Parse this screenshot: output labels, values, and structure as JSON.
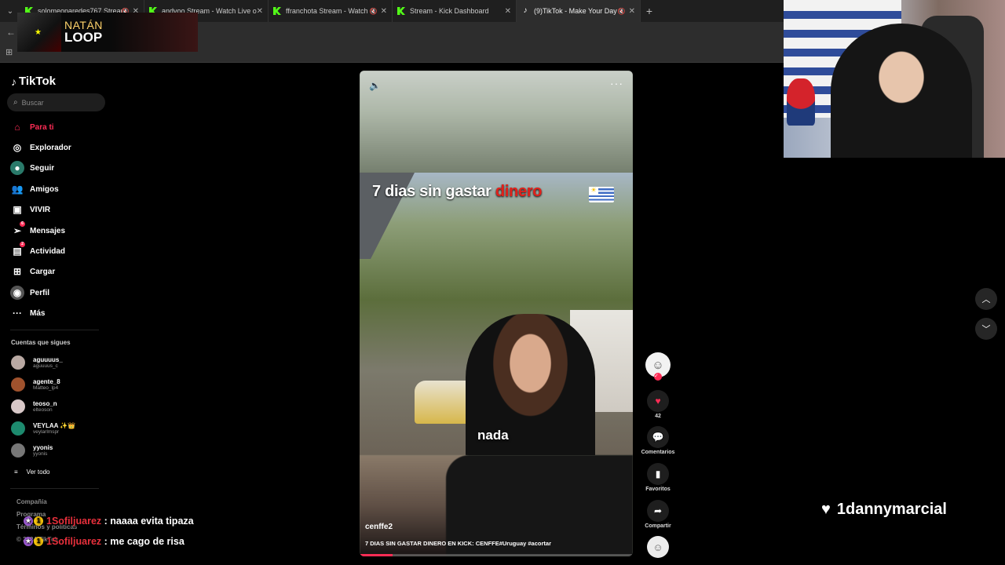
{
  "browser": {
    "tabs": [
      {
        "title": "solomeoparedes767 Stream",
        "icon": "kick-icon",
        "muted": true,
        "active": false
      },
      {
        "title": "andvoo Stream - Watch Live on",
        "icon": "kick-icon",
        "muted": false,
        "active": false
      },
      {
        "title": "ffranchota Stream - Watch",
        "icon": "kick-icon",
        "muted": true,
        "active": false
      },
      {
        "title": "Stream - Kick Dashboard",
        "icon": "kick-icon",
        "muted": false,
        "active": false
      },
      {
        "title": "(9)TikTok - Make Your Day",
        "icon": "tiktok-icon",
        "muted": true,
        "active": true
      }
    ],
    "new_tab": "+"
  },
  "now_playing": {
    "line1": "NATÁN",
    "line2": "LOOP"
  },
  "tiktok": {
    "logo": "TikTok",
    "search_placeholder": "Buscar",
    "menu": [
      {
        "label": "Para ti",
        "icon": "home-icon",
        "active": true
      },
      {
        "label": "Explorador",
        "icon": "compass-icon"
      },
      {
        "label": "Seguir",
        "icon": "following-icon"
      },
      {
        "label": "Amigos",
        "icon": "friends-icon"
      },
      {
        "label": "VIVIR",
        "icon": "live-icon"
      },
      {
        "label": "Mensajes",
        "icon": "messages-icon",
        "badge": "6"
      },
      {
        "label": "Actividad",
        "icon": "activity-icon",
        "badge": "2"
      },
      {
        "label": "Cargar",
        "icon": "upload-icon"
      },
      {
        "label": "Perfil",
        "icon": "profile-icon"
      },
      {
        "label": "Más",
        "icon": "more-icon"
      }
    ],
    "following_title": "Cuentas que sigues",
    "following": [
      {
        "name": "aguuuus_",
        "handle": "aguuuus_c",
        "color": "#b9a9a3"
      },
      {
        "name": "agente_8",
        "handle": "Matteo_lp4",
        "color": "#a0522d"
      },
      {
        "name": "teoso_n",
        "handle": "elteoson",
        "color": "#d8c8c8"
      },
      {
        "name": "VEYLAA ✨👑",
        "handle": "veylarlmspr",
        "color": "#1d8a6e"
      },
      {
        "name": "yyonis",
        "handle": "yyonis",
        "color": "#777777"
      }
    ],
    "see_all": "Ver todo",
    "footer": [
      "Compañía",
      "Programa",
      "Términos y políticas",
      "© 2024 TikTok"
    ]
  },
  "video": {
    "title_white": "7 dias sin gastar",
    "title_red": "dinero",
    "caption_word": "nada",
    "author": "cenffe2",
    "description": "7 DIAS SIN GASTAR DINERO EN KICK: CENFFE#Uruguay #acortar",
    "progress": 0.12
  },
  "actions": {
    "likes": "42",
    "comments_label": "Comentarios",
    "favorites_label": "Favoritos",
    "share_label": "Compartir"
  },
  "chat": [
    {
      "user": "1Sofiljuarez",
      "message": ": naaaa evita tipaza"
    },
    {
      "user": "1Sofiljuarez",
      "message": ": me cago de risa"
    }
  ],
  "follower_alert": "1dannymarcial",
  "colors": {
    "accent": "#fe2c55",
    "kick": "#53fc18",
    "chat_user": "#e8303c"
  }
}
